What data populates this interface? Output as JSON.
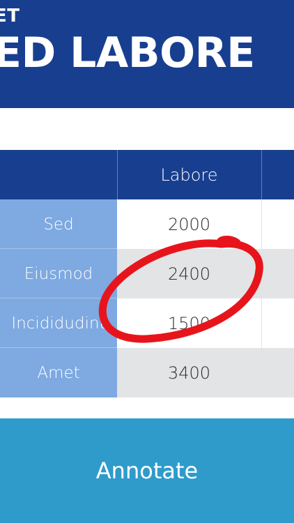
{
  "header": {
    "eyebrow": "ET",
    "title": "ED LABORE",
    "background_color": "#183f8f"
  },
  "table": {
    "column_header": "Labore",
    "rows": [
      {
        "label": "Sed",
        "value": "2000"
      },
      {
        "label": "Eiusmod",
        "value": "2400"
      },
      {
        "label": "Incididudint",
        "value": "1500"
      },
      {
        "label": "Amet",
        "value": "3400"
      }
    ],
    "label_column_color": "#7ea9e1",
    "alt_row_color": "#e3e4e6"
  },
  "annotation": {
    "shape": "freehand-ellipse",
    "color": "#e8141c",
    "highlighted_row": "Incididudint"
  },
  "action_button": {
    "label": "Annotate",
    "color": "#2f9bcb"
  }
}
